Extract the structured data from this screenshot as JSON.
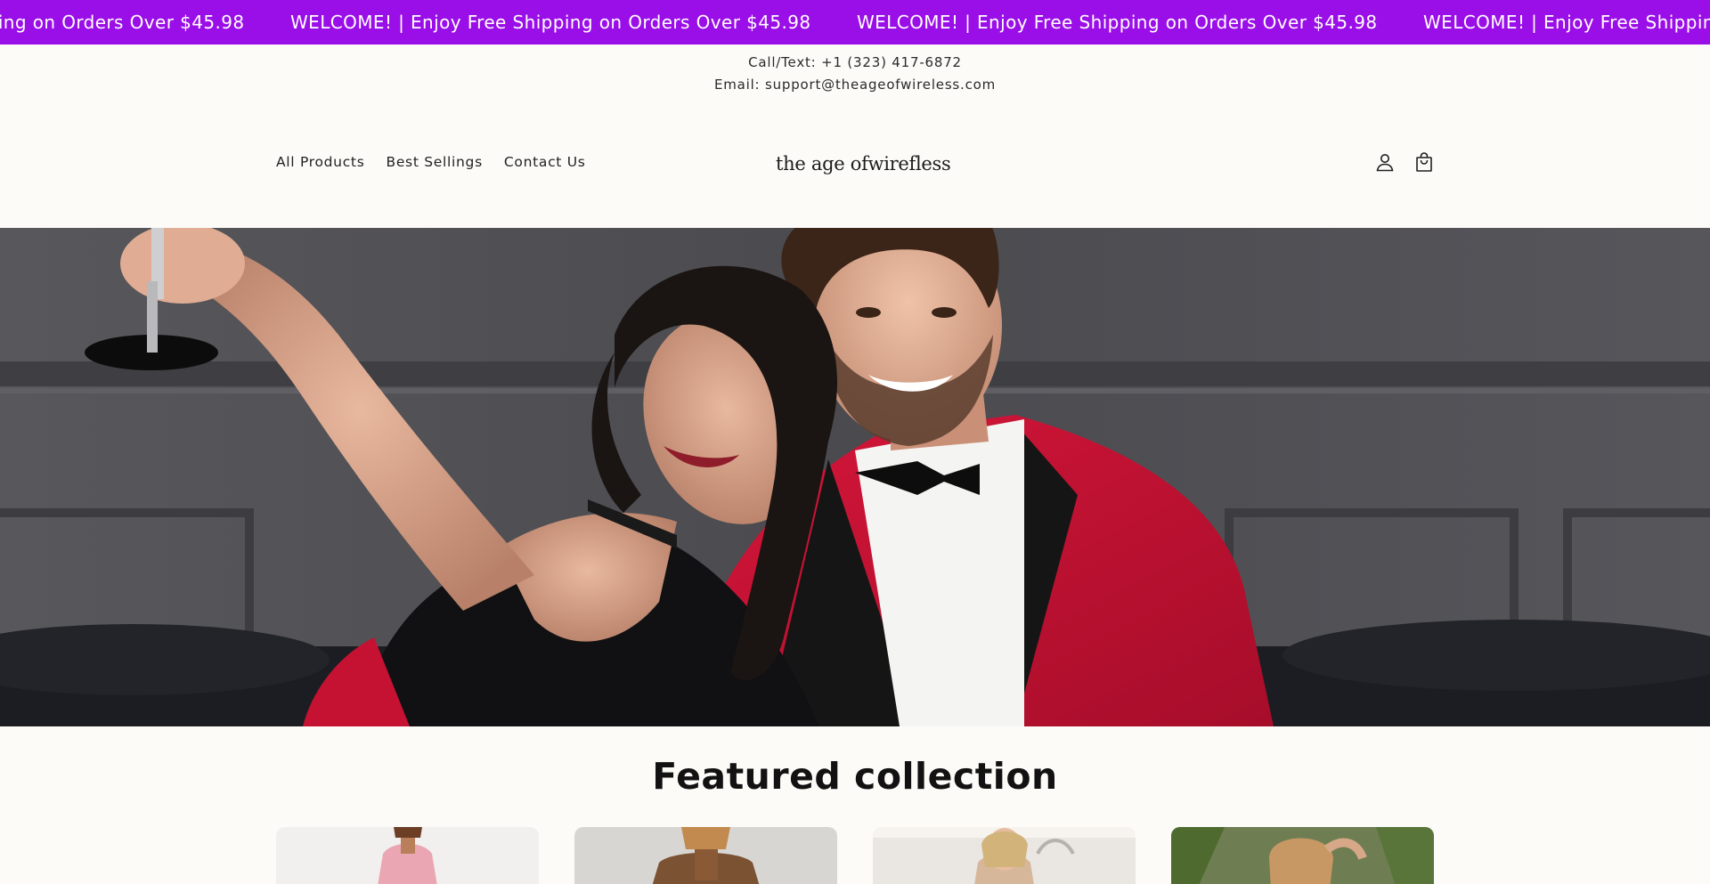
{
  "announcement": {
    "text": "WELCOME! | Enjoy Free Shipping on Orders Over $45.98",
    "background": "#9a0ee8"
  },
  "contact": {
    "phone": "Call/Text: +1 (323) 417-6872",
    "email": "Email: support@theageofwireless.com"
  },
  "header": {
    "nav": [
      "All Products",
      "Best Sellings",
      "Contact Us"
    ],
    "logo": "the age ofwirefless",
    "icons": [
      "account-icon",
      "cart-icon"
    ]
  },
  "featured": {
    "title": "Featured collection"
  }
}
